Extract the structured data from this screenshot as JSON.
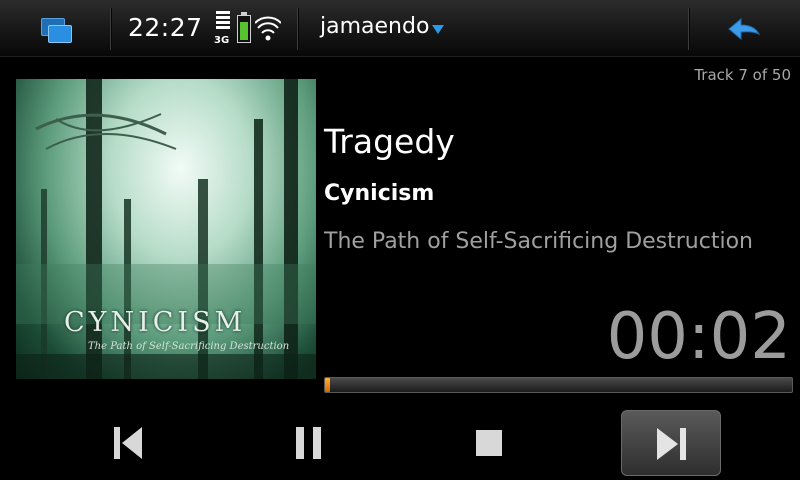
{
  "status_bar": {
    "time": "22:27",
    "network": "3G",
    "app_name": "jamaendo",
    "signal_bars": 4,
    "battery_level": 0.8,
    "icons": [
      "task-switcher-icon",
      "signal-strength-icon",
      "battery-icon",
      "wifi-icon",
      "dropdown-arrow-icon",
      "back-arrow-icon"
    ]
  },
  "player": {
    "track_position": "Track 7 of 50",
    "title": "Tragedy",
    "artist": "Cynicism",
    "album": "The Path of Self-Sacrificing Destruction",
    "elapsed": "00:02",
    "progress": 0.01,
    "cover": {
      "band_text": "CYNICISM",
      "album_text": "The Path of Self-Sacrificing Destruction"
    }
  },
  "controls": {
    "buttons": [
      "previous-icon",
      "pause-icon",
      "stop-icon",
      "next-icon"
    ],
    "active": "next"
  },
  "colors": {
    "accent": "#2a9ae8",
    "progress": "#f39a1c",
    "battery": "#56c32f"
  }
}
